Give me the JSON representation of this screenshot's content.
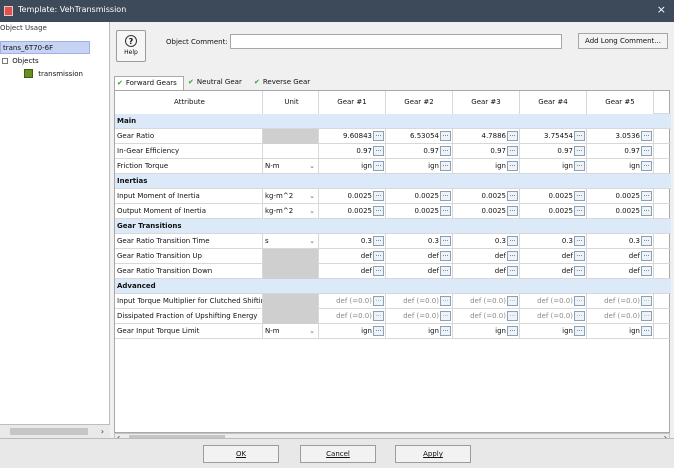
{
  "window": {
    "title": "Template: VehTransmission",
    "close_glyph": "×"
  },
  "left_panel": {
    "header": "Object Usage",
    "selected_item": "trans_6T70-6F",
    "objects_label": "Objects",
    "child_item": "transmission"
  },
  "toolbar": {
    "help_label": "Help",
    "comment_label": "Object Comment:",
    "comment_value": "",
    "long_comment_button": "Add Long Comment..."
  },
  "tabs": [
    {
      "label": "Forward Gears"
    },
    {
      "label": "Neutral Gear"
    },
    {
      "label": "Reverse Gear"
    }
  ],
  "table": {
    "headers": {
      "attribute": "Attribute",
      "unit": "Unit",
      "gears": [
        "Gear #1",
        "Gear #2",
        "Gear #3",
        "Gear #4",
        "Gear #5"
      ]
    },
    "sections": {
      "main": "Main",
      "inertias": "Inertias",
      "transitions": "Gear Transitions",
      "advanced": "Advanced"
    },
    "rows": {
      "gear_ratio": {
        "attr": "Gear Ratio",
        "unit": "",
        "values": [
          "9.60843",
          "6.53054",
          "4.7886",
          "3.75454",
          "3.0536"
        ]
      },
      "efficiency": {
        "attr": "In-Gear Efficiency",
        "unit": "",
        "values": [
          "0.97",
          "0.97",
          "0.97",
          "0.97",
          "0.97"
        ]
      },
      "friction": {
        "attr": "Friction Torque",
        "unit": "N-m",
        "values": [
          "ign",
          "ign",
          "ign",
          "ign",
          "ign"
        ]
      },
      "input_moi": {
        "attr": "Input Moment of Inertia",
        "unit": "kg-m^2",
        "values": [
          "0.0025",
          "0.0025",
          "0.0025",
          "0.0025",
          "0.0025"
        ]
      },
      "output_moi": {
        "attr": "Output Moment of Inertia",
        "unit": "kg-m^2",
        "values": [
          "0.0025",
          "0.0025",
          "0.0025",
          "0.0025",
          "0.0025"
        ]
      },
      "transition_time": {
        "attr": "Gear Ratio Transition Time",
        "unit": "s",
        "values": [
          "0.3",
          "0.3",
          "0.3",
          "0.3",
          "0.3"
        ]
      },
      "transition_up": {
        "attr": "Gear Ratio Transition Up",
        "unit": "",
        "values": [
          "def",
          "def",
          "def",
          "def",
          "def"
        ]
      },
      "transition_down": {
        "attr": "Gear Ratio Transition Down",
        "unit": "",
        "values": [
          "def",
          "def",
          "def",
          "def",
          "def"
        ]
      },
      "torque_mult": {
        "attr": "Input Torque Multiplier for Clutched Shifting",
        "unit": "",
        "values": [
          "def (=0.0)",
          "def (=0.0)",
          "def (=0.0)",
          "def (=0.0)",
          "def (=0.0)"
        ]
      },
      "dissipated": {
        "attr": "Dissipated Fraction of Upshifting Energy",
        "unit": "",
        "values": [
          "def (=0.0)",
          "def (=0.0)",
          "def (=0.0)",
          "def (=0.0)",
          "def (=0.0)"
        ]
      },
      "torque_limit": {
        "attr": "Gear Input Torque Limit",
        "unit": "N-m",
        "values": [
          "ign",
          "ign",
          "ign",
          "ign",
          "ign"
        ]
      }
    }
  },
  "footer": {
    "ok": "OK",
    "cancel": "Cancel",
    "apply": "Apply"
  },
  "colors": {
    "titlebar": "#3d4a5a",
    "section_bg": "#dbe9f8",
    "check_green": "#2e9b3a"
  }
}
